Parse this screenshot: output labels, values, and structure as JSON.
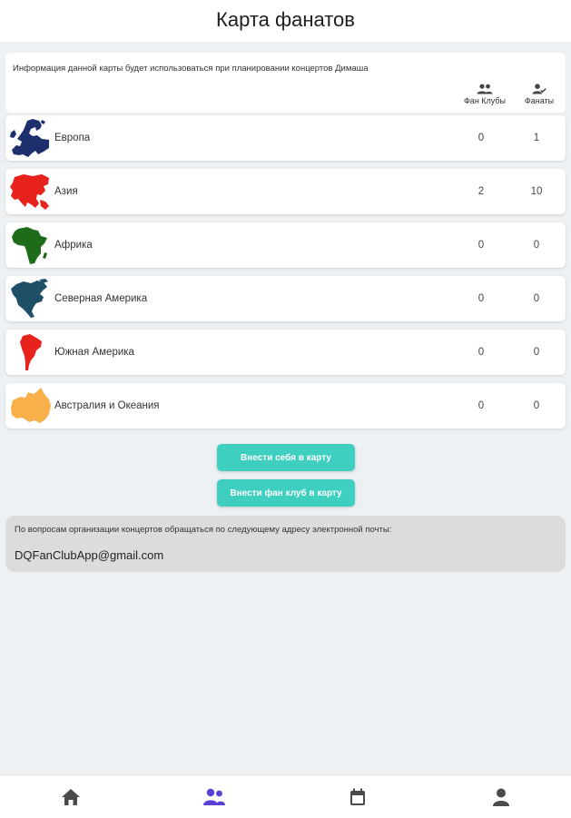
{
  "header": {
    "title": "Карта фанатов"
  },
  "info": {
    "text": "Информация данной карты будет использоваться при планировании концертов Димаша",
    "col_clubs_label": "Фан Клубы",
    "col_fans_label": "Фанаты",
    "col_clubs_icon": "group-icon",
    "col_fans_icon": "person-check-icon"
  },
  "regions": [
    {
      "name": "Европа",
      "clubs": "0",
      "fans": "1",
      "color": "#1e2f6e"
    },
    {
      "name": "Азия",
      "clubs": "2",
      "fans": "10",
      "color": "#e8231d"
    },
    {
      "name": "Африка",
      "clubs": "0",
      "fans": "0",
      "color": "#1e6b1a"
    },
    {
      "name": "Северная Америка",
      "clubs": "0",
      "fans": "0",
      "color": "#1f4f66"
    },
    {
      "name": "Южная Америка",
      "clubs": "0",
      "fans": "0",
      "color": "#e8231d"
    },
    {
      "name": "Австралия и Океания",
      "clubs": "0",
      "fans": "0",
      "color": "#f7b04a"
    }
  ],
  "buttons": {
    "add_self": "Внести себя в карту",
    "add_club": "Внести фан клуб в карту"
  },
  "contact": {
    "text": "По вопросам организации концертов обращаться по следующему адресу электронной почты:",
    "email": "DQFanClubApp@gmail.com"
  },
  "nav": {
    "items": [
      "home-icon",
      "people-icon",
      "calendar-icon",
      "user-icon"
    ],
    "active_color": "#5a3fd6",
    "inactive_color": "#4a4a4a",
    "accent": "#3fcfc0"
  }
}
